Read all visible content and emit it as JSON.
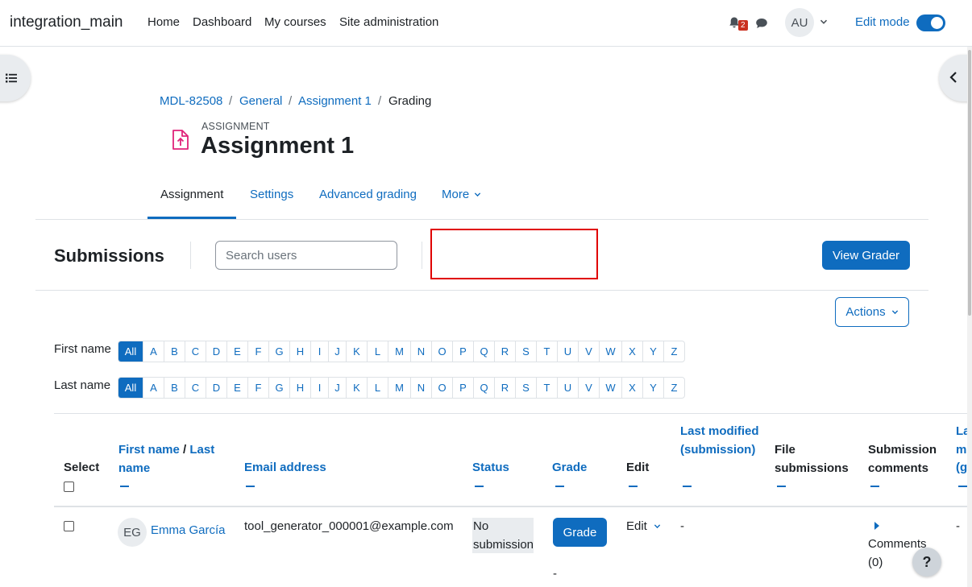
{
  "navbar": {
    "brand": "integration_main",
    "links": [
      "Home",
      "Dashboard",
      "My courses",
      "Site administration"
    ],
    "notification_count": "2",
    "user_initials": "AU",
    "edit_mode_label": "Edit mode",
    "edit_mode_on": true
  },
  "breadcrumb": [
    "MDL-82508",
    "General",
    "Assignment 1",
    "Grading"
  ],
  "breadcrumb_separator": "/",
  "header": {
    "eyebrow": "ASSIGNMENT",
    "title": "Assignment 1"
  },
  "secondary_nav": {
    "tabs": [
      "Assignment",
      "Settings",
      "Advanced grading",
      "More"
    ],
    "active": "Assignment"
  },
  "submissions": {
    "title": "Submissions",
    "search_placeholder": "Search users",
    "view_grader_label": "View Grader",
    "actions_label": "Actions"
  },
  "initials": {
    "first_name_label": "First name",
    "last_name_label": "Last name",
    "all_label": "All",
    "letters": [
      "A",
      "B",
      "C",
      "D",
      "E",
      "F",
      "G",
      "H",
      "I",
      "J",
      "K",
      "L",
      "M",
      "N",
      "O",
      "P",
      "Q",
      "R",
      "S",
      "T",
      "U",
      "V",
      "W",
      "X",
      "Y",
      "Z"
    ]
  },
  "table": {
    "headers": {
      "select": "Select",
      "first_name": "First name",
      "name_sep": " / ",
      "last_name": "Last name",
      "email": "Email address",
      "status": "Status",
      "grade": "Grade",
      "edit": "Edit",
      "last_modified": "Last modified (submission)",
      "file_submissions": "File submissions",
      "submission_comments": "Submission comments",
      "last_modified_grade_partial": "La m (g"
    },
    "rows": [
      {
        "initials": "EG",
        "name": "Emma García",
        "email": "tool_generator_000001@example.com",
        "status": "No submission",
        "grade_button": "Grade",
        "grade_value": "-",
        "edit_label": "Edit",
        "last_modified": "-",
        "comments": "Comments (0)",
        "last_col": "-"
      }
    ]
  },
  "help_label": "?",
  "colors": {
    "primary": "#0f6cbf",
    "notification": "#ca3120",
    "highlight": "#e00000",
    "activity_icon": "#e0237a"
  }
}
